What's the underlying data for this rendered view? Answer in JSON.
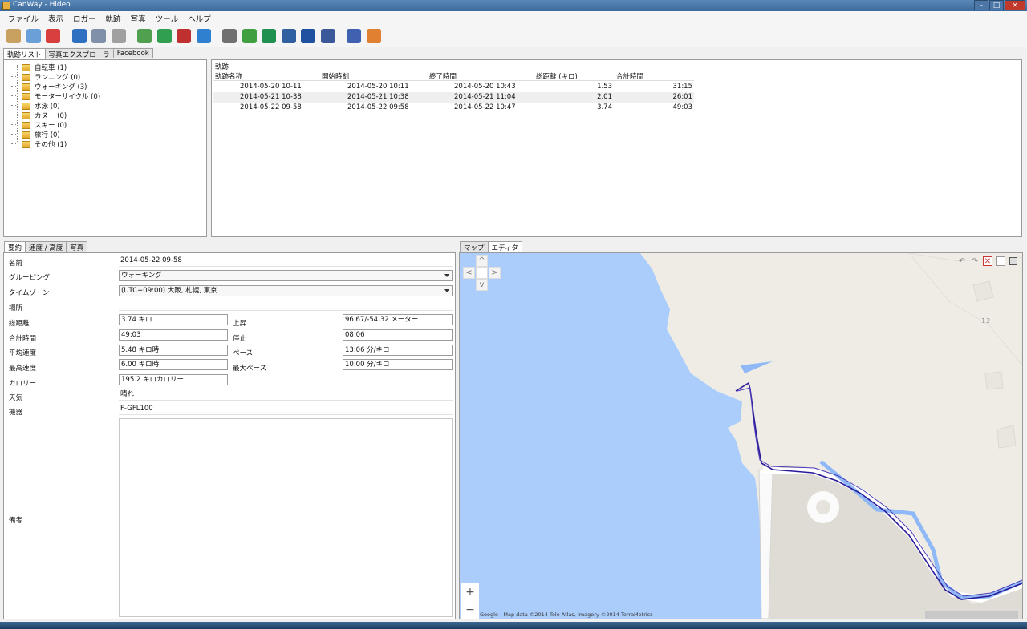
{
  "window": {
    "title": "CanWay - Hideo",
    "controls": [
      "–",
      "□",
      "×"
    ]
  },
  "menu": [
    "ファイル",
    "表示",
    "ロガー",
    "軌跡",
    "写真",
    "ツール",
    "ヘルプ"
  ],
  "toolbar": {
    "tools": [
      {
        "icon": "import-gps-icon",
        "color": "#c8a060"
      },
      {
        "icon": "track-chart-icon",
        "color": "#6aa0d8"
      },
      {
        "icon": "bar-chart-icon",
        "color": "#d84040"
      },
      {
        "icon": "device-icon",
        "color": "#3070c0"
      },
      {
        "icon": "database-icon",
        "color": "#8090a8"
      },
      {
        "icon": "database-edit-icon",
        "color": "#a0a0a0"
      },
      {
        "icon": "track-delete-icon",
        "color": "#50a050"
      },
      {
        "icon": "photo-add-icon",
        "color": "#30a050"
      },
      {
        "icon": "photo-remove-icon",
        "color": "#c03030"
      },
      {
        "icon": "rotate-icon",
        "color": "#3080d0"
      },
      {
        "icon": "tools-icon",
        "color": "#707070"
      },
      {
        "icon": "export-csv-icon",
        "color": "#40a040"
      },
      {
        "icon": "export-gpx-icon",
        "color": "#209050"
      },
      {
        "icon": "export-kml-icon",
        "color": "#3060a0"
      },
      {
        "icon": "google-earth-icon",
        "color": "#2050a0"
      },
      {
        "icon": "facebook-icon",
        "color": "#3b5998"
      },
      {
        "icon": "help-icon",
        "color": "#4060b0"
      },
      {
        "icon": "exit-icon",
        "color": "#e08030"
      }
    ]
  },
  "left_tabs": [
    "軌跡リスト",
    "写真エクスプローラ",
    "Facebook"
  ],
  "tree": [
    {
      "label": "自転車 (1)"
    },
    {
      "label": "ランニング (0)"
    },
    {
      "label": "ウォーキング (3)"
    },
    {
      "label": "モーターサイクル (0)"
    },
    {
      "label": "水泳 (0)"
    },
    {
      "label": "カヌー (0)"
    },
    {
      "label": "スキー (0)"
    },
    {
      "label": "旅行 (0)"
    },
    {
      "label": "その他 (1)"
    }
  ],
  "tracks": {
    "group_label": "軌跡",
    "columns": [
      "軌跡名称",
      "開始時刻",
      "終了時間",
      "総距離 (キロ)",
      "合計時間"
    ],
    "rows": [
      [
        "2014-05-20 10-11",
        "2014-05-20 10:11",
        "2014-05-20 10:43",
        "1.53",
        "31:15"
      ],
      [
        "2014-05-21 10-38",
        "2014-05-21 10:38",
        "2014-05-21 11:04",
        "2.01",
        "26:01"
      ],
      [
        "2014-05-22 09-58",
        "2014-05-22 09:58",
        "2014-05-22 10:47",
        "3.74",
        "49:03"
      ]
    ]
  },
  "detail_tabs": [
    "要約",
    "速度 / 高度",
    "写真"
  ],
  "summary": {
    "name_label": "名前",
    "name": "2014-05-22 09-58",
    "grouping_label": "グルーピング",
    "grouping": "ウォーキング",
    "timezone_label": "タイムゾーン",
    "timezone": "(UTC+09:00) 大阪, 札幌, 東京",
    "place_label": "場所",
    "place": "",
    "distance_label": "総距離",
    "distance": "3.74 キロ",
    "ascent_label": "上昇",
    "ascent": "96.67/-54.32 メーター",
    "total_time_label": "合計時間",
    "total_time": "49:03",
    "stop_label": "停止",
    "stop": "08:06",
    "avg_speed_label": "平均速度",
    "avg_speed": "5.48 キロ時",
    "pace_label": "ペース",
    "pace": "13:06 分/キロ",
    "max_speed_label": "最高速度",
    "max_speed": "6.00 キロ時",
    "max_pace_label": "最大ペース",
    "max_pace": "10:00 分/キロ",
    "calorie_label": "カロリー",
    "calorie": "195.2 キロカロリー",
    "weather_label": "天気",
    "weather": "晴れ",
    "device_label": "機器",
    "device": "F-GFL100",
    "memo_label": "備考",
    "memo": ""
  },
  "map_tabs": [
    "マップ",
    "エディタ"
  ],
  "map": {
    "credit": "Google - Map data ©2014 Tele Atlas, Imagery ©2014 TerraMetrics",
    "label_12": "12",
    "zoom_in": "+",
    "zoom_out": "−",
    "pan": {
      "up": "^",
      "left": "<",
      "right": ">",
      "down": "v"
    },
    "tools": {
      "undo": "↶",
      "redo": "↷",
      "delete": "✕"
    },
    "colors": {
      "water": "#abcdfb",
      "land": "#efece6",
      "track": "#2a1a9a"
    }
  }
}
